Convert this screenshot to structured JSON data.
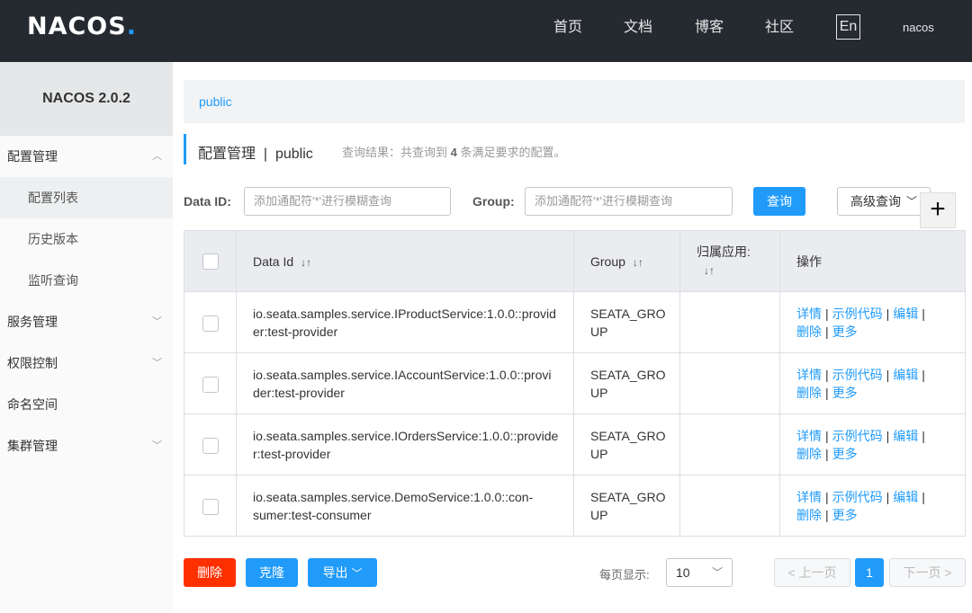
{
  "header": {
    "logo": "NACOS",
    "logo_dot": ".",
    "nav": [
      "首页",
      "文档",
      "博客",
      "社区"
    ],
    "lang": "En",
    "user": "nacos"
  },
  "sidebar": {
    "title": "NACOS 2.0.2",
    "items": [
      {
        "label": "配置管理"
      },
      {
        "label": "配置列表"
      },
      {
        "label": "历史版本"
      },
      {
        "label": "监听查询"
      },
      {
        "label": "服务管理"
      },
      {
        "label": "权限控制"
      },
      {
        "label": "命名空间"
      },
      {
        "label": "集群管理"
      }
    ]
  },
  "main": {
    "namespace_tab": "public",
    "title": "配置管理",
    "title_sep": "|",
    "title_ns": "public",
    "result_prefix": "查询结果：共查询到",
    "result_count": "4",
    "result_suffix": "条满足要求的配置。",
    "search": {
      "data_id_label": "Data ID:",
      "data_id_placeholder": "添加通配符'*'进行模糊查询",
      "group_label": "Group:",
      "group_placeholder": "添加通配符'*'进行模糊查询",
      "query_button": "查询",
      "advanced_button": "高级查询",
      "add_button": "+"
    },
    "table": {
      "headers": {
        "data_id": "Data Id",
        "group": "Group",
        "app": "归属应用:",
        "ops": "操作"
      },
      "rows": [
        {
          "data_id_1": "io.seata.samples.service.IProductService:1.0.0::provid",
          "data_id_2": "er:test-provider",
          "group_1": "SEATA_GRO",
          "group_2": "UP"
        },
        {
          "data_id_1": "io.seata.samples.service.IAccountService:1.0.0::provi",
          "data_id_2": "der:test-provider",
          "group_1": "SEATA_GRO",
          "group_2": "UP"
        },
        {
          "data_id_1": "io.seata.samples.service.IOrdersService:1.0.0::provide",
          "data_id_2": "r:test-provider",
          "group_1": "SEATA_GRO",
          "group_2": "UP"
        },
        {
          "data_id_1": "io.seata.samples.service.DemoService:1.0.0::con-",
          "data_id_2": "sumer:test-consumer",
          "group_1": "SEATA_GRO",
          "group_2": "UP"
        }
      ],
      "ops": {
        "detail": "详情",
        "sample": "示例代码",
        "edit": "编辑",
        "delete": "删除",
        "more": "更多",
        "sep": "|"
      }
    },
    "footer": {
      "delete_button": "删除",
      "clone_button": "克隆",
      "export_button": "导出",
      "per_page_label": "每页显示:",
      "per_page_value": "10",
      "prev": "上一页",
      "current_page": "1",
      "next": "下一页"
    }
  },
  "colors": {
    "accent": "#209bfa",
    "danger": "#ff3000",
    "topbar": "#252a31"
  }
}
